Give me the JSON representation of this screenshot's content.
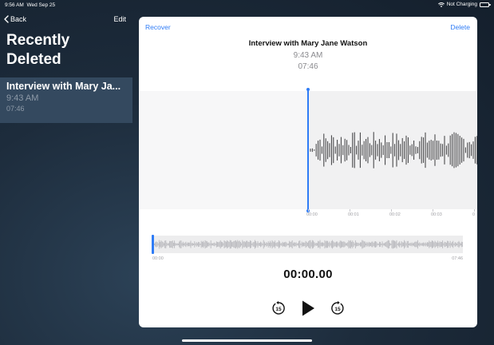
{
  "status_bar": {
    "time": "9:56 AM",
    "date": "Wed Sep 25",
    "charging": "Not Charging",
    "icons": [
      "wifi-icon",
      "battery-icon"
    ]
  },
  "sidebar": {
    "back_label": "Back",
    "edit_label": "Edit",
    "title_line1": "Recently",
    "title_line2": "Deleted",
    "items": [
      {
        "title": "Interview with Mary Ja...",
        "time": "9:43 AM",
        "duration": "07:46"
      }
    ]
  },
  "detail": {
    "recover_label": "Recover",
    "delete_label": "Delete",
    "title": "Interview with Mary Jane Watson",
    "time": "9:43 AM",
    "duration": "07:46",
    "timeline_ticks": [
      "00:00",
      "00:01",
      "00:02",
      "00:03",
      "0"
    ],
    "overview_start": "00:00",
    "overview_end": "07:46",
    "current_time": "00:00.00",
    "skip_back_seconds": "15",
    "skip_forward_seconds": "15",
    "colors": {
      "accent": "#2f7cf6",
      "wave": "#3a3a3c",
      "overview_wave": "#b8b8bc"
    }
  }
}
